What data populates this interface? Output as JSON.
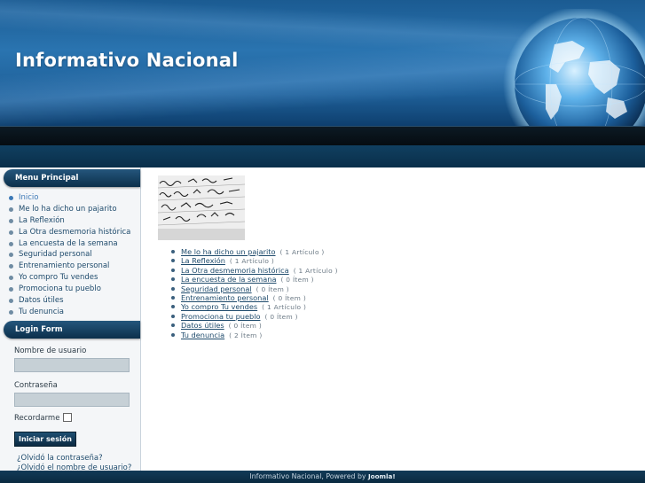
{
  "site": {
    "title": "Informativo Nacional"
  },
  "menu": {
    "title": "Menu Principal",
    "items": [
      {
        "label": "Inicio"
      },
      {
        "label": "Me lo ha dicho un pajarito"
      },
      {
        "label": "La Reflexión"
      },
      {
        "label": "La Otra desmemoria histórica"
      },
      {
        "label": "La encuesta de la semana"
      },
      {
        "label": "Seguridad personal"
      },
      {
        "label": "Entrenamiento personal"
      },
      {
        "label": "Yo compro Tu vendes"
      },
      {
        "label": "Promociona tu pueblo"
      },
      {
        "label": "Datos útiles"
      },
      {
        "label": "Tu denuncia"
      }
    ]
  },
  "login": {
    "title": "Login Form",
    "username_label": "Nombre de usuario",
    "username_value": "",
    "password_label": "Contraseña",
    "password_value": "",
    "remember_label": "Recordarme",
    "submit_label": "Iniciar sesión",
    "forgot_password": "¿Olvidó la contraseña?",
    "forgot_username": "¿Olvidó el nombre de usuario?"
  },
  "categories": [
    {
      "name": "Me lo ha dicho un pajarito",
      "count": "( 1 Artículo )"
    },
    {
      "name": "La Reflexión",
      "count": "( 1 Artículo )"
    },
    {
      "name": "La Otra desmemoria histórica",
      "count": "( 1 Artículo )"
    },
    {
      "name": "La encuesta de la semana",
      "count": "( 0 Ítem )"
    },
    {
      "name": "Seguridad personal",
      "count": "( 0 Ítem )"
    },
    {
      "name": "Entrenamiento personal",
      "count": "( 0 Ítem )"
    },
    {
      "name": "Yo compro Tu vendes",
      "count": "( 1 Artículo )"
    },
    {
      "name": "Promociona tu pueblo",
      "count": "( 0 Ítem )"
    },
    {
      "name": "Datos útiles",
      "count": "( 0 Ítem )"
    },
    {
      "name": "Tu denuncia",
      "count": "( 2 Ítem )"
    }
  ],
  "footer": {
    "text": "Informativo Nacional, Powered by",
    "brand": "Joomla!"
  },
  "colors": {
    "header": "#1e5f98",
    "nav": "#0a2f4a",
    "link": "#1f4b6c",
    "active": "#3d79b6"
  }
}
